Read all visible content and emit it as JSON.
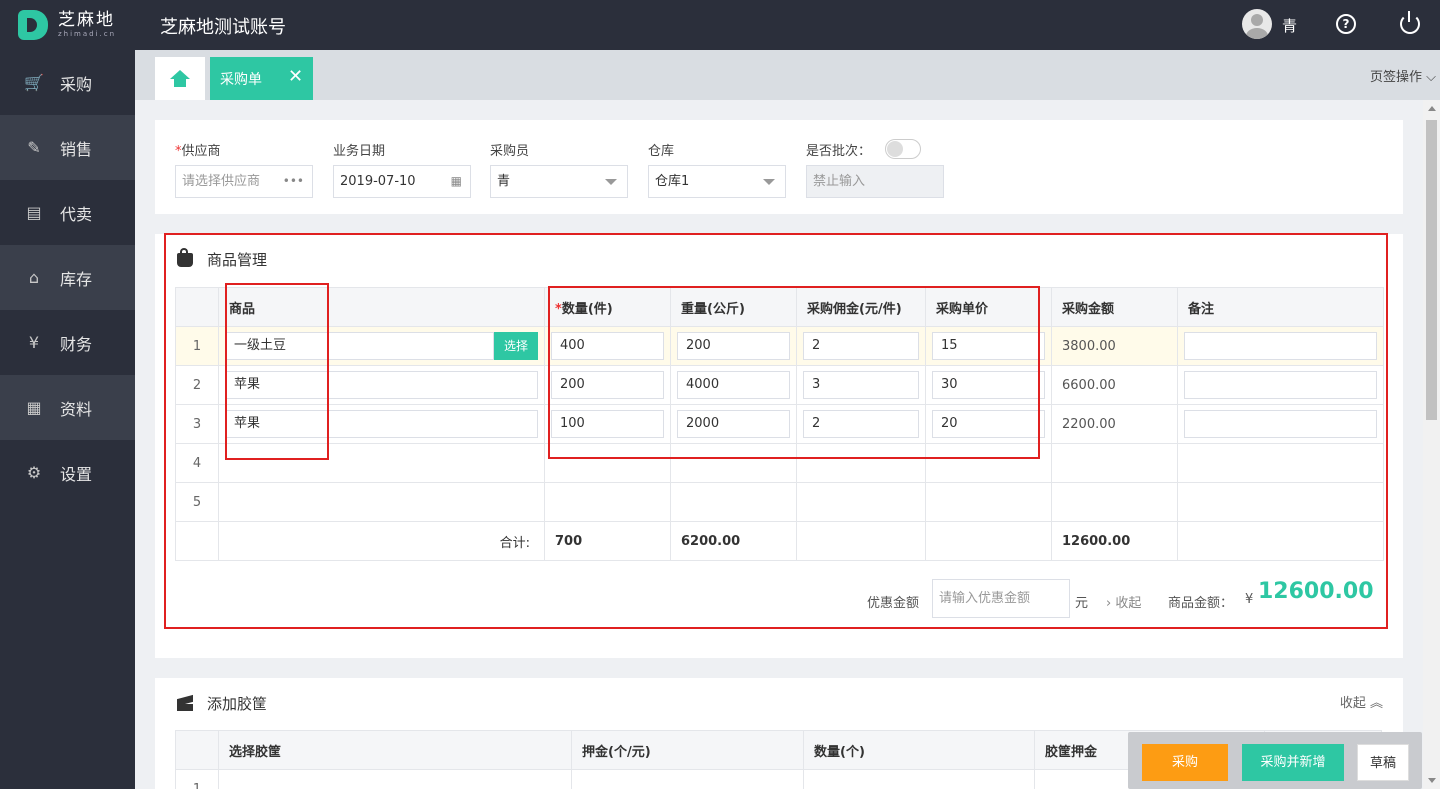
{
  "header": {
    "logo_cn": "芝麻地",
    "logo_en": "zhimadi.cn",
    "account_name": "芝麻地测试账号",
    "username": "青",
    "help_glyph": "?"
  },
  "sidebar": {
    "items": [
      {
        "label": "采购",
        "icon": "cart-icon",
        "glyph": "🛒"
      },
      {
        "label": "销售",
        "icon": "sale-icon",
        "glyph": "✎"
      },
      {
        "label": "代卖",
        "icon": "consign-icon",
        "glyph": "▤"
      },
      {
        "label": "库存",
        "icon": "warehouse-icon",
        "glyph": "⌂"
      },
      {
        "label": "财务",
        "icon": "finance-icon",
        "glyph": "¥"
      },
      {
        "label": "资料",
        "icon": "profile-icon",
        "glyph": "▦"
      },
      {
        "label": "设置",
        "icon": "gear-icon",
        "glyph": "⚙"
      }
    ]
  },
  "tabs": {
    "active_label": "采购单",
    "close_glyph": "✕",
    "ops_label": "页签操作 ⌵"
  },
  "form": {
    "supplier_label": "供应商",
    "supplier_required": "*",
    "supplier_placeholder": "请选择供应商",
    "supplier_more": "•••",
    "date_label": "业务日期",
    "date_value": "2019-07-10",
    "date_icon": "▦",
    "buyer_label": "采购员",
    "buyer_value": "青",
    "warehouse_label": "仓库",
    "warehouse_value": "仓库1",
    "batch_label": "是否批次：",
    "batch_on": false,
    "batch_placeholder": "禁止输入"
  },
  "goods": {
    "title": "商品管理",
    "columns": {
      "product": "商品",
      "qty_required": "*",
      "qty": "数量(件)",
      "weight": "重量(公斤)",
      "commission": "采购佣金(元/件)",
      "unit_price": "采购单价",
      "amount": "采购金额",
      "remark": "备注"
    },
    "pick_label": "选择",
    "rows": [
      {
        "no": "1",
        "product": "一级土豆",
        "qty": "400",
        "weight": "200",
        "commission": "2",
        "unit_price": "15",
        "amount": "3800.00",
        "remark": ""
      },
      {
        "no": "2",
        "product": "苹果",
        "qty": "200",
        "weight": "4000",
        "commission": "3",
        "unit_price": "30",
        "amount": "6600.00",
        "remark": ""
      },
      {
        "no": "3",
        "product": "苹果",
        "qty": "100",
        "weight": "2000",
        "commission": "2",
        "unit_price": "20",
        "amount": "2200.00",
        "remark": ""
      },
      {
        "no": "4"
      },
      {
        "no": "5"
      }
    ],
    "totals": {
      "label": "合计:",
      "qty": "700",
      "weight": "6200.00",
      "amount": "12600.00"
    },
    "discount_label": "优惠金额",
    "discount_placeholder": "请输入优惠金额",
    "discount_unit": "元",
    "collapse_label": "› 收起",
    "goods_amount_label": "商品金额：",
    "currency": "¥",
    "goods_amount_value": "12600.00"
  },
  "crates": {
    "title": "添加胶筐",
    "collapse_label": "收起 ︽",
    "columns": {
      "crate": "选择胶筐",
      "deposit_unit": "押金(个/元)",
      "qty": "数量(个)",
      "deposit": "胶筐押金"
    },
    "first_row_no": "1"
  },
  "actions": {
    "buy": "采购",
    "buy_new": "采购并新增",
    "draft": "草稿"
  },
  "colors": {
    "accent": "#2ec7a3",
    "warning": "#fd9c13",
    "annotation": "#e02020",
    "topbar": "#2b2f3b"
  }
}
